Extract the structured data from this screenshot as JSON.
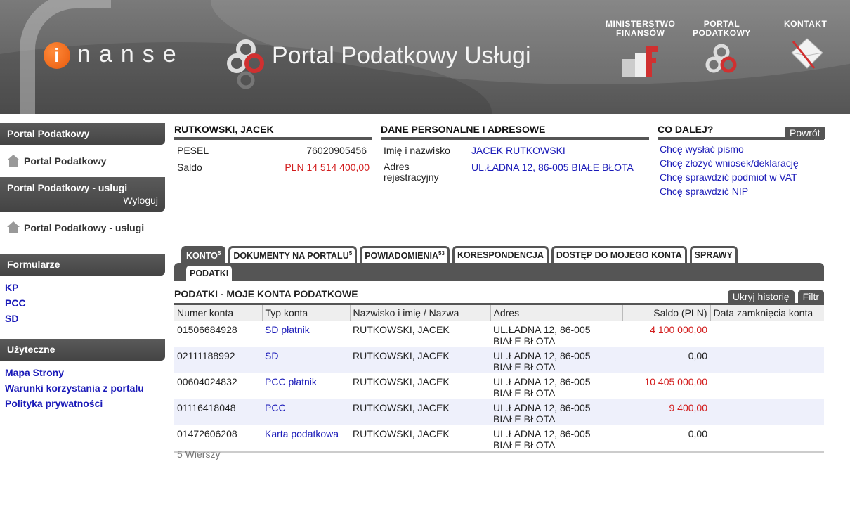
{
  "header": {
    "logo_letter": "i",
    "logo_rest": "nanse",
    "portal_title": "Portal Podatkowy Usługi",
    "links": [
      {
        "label_line1": "MINISTERSTWO",
        "label_line2": "FINANSÓW",
        "icon": "ministry-logo-icon"
      },
      {
        "label_line1": "PORTAL",
        "label_line2": "PODATKOWY",
        "icon": "portal-logo-icon"
      },
      {
        "label_line1": "KONTAKT",
        "label_line2": "",
        "icon": "envelope-icon"
      }
    ]
  },
  "sidebar": {
    "section1": {
      "title": "Portal Podatkowy",
      "home": "Portal Podatkowy"
    },
    "section2": {
      "title": "Portal Podatkowy - usługi",
      "logout": "Wyloguj",
      "home": "Portal Podatkowy - usługi"
    },
    "formularze": {
      "title": "Formularze",
      "items": [
        "KP",
        "PCC",
        "SD"
      ]
    },
    "uzyteczne": {
      "title": "Użyteczne",
      "items": [
        "Mapa Strony",
        "Warunki korzystania z portalu",
        "Polityka prywatności"
      ]
    }
  },
  "person": {
    "title": "RUTKOWSKI, JACEK",
    "pesel_label": "PESEL",
    "pesel_value": "76020905456",
    "saldo_label": "Saldo",
    "saldo_value": "PLN 14 514 400,00"
  },
  "personal": {
    "title": "DANE PERSONALNE I ADRESOWE",
    "name_label": "Imię i nazwisko",
    "name_value": "JACEK RUTKOWSKI",
    "address_label": "Adres rejestracyjny",
    "address_value": "UL.ŁADNA 12, 86-005 BIAŁE BŁOTA"
  },
  "next": {
    "title": "CO DALEJ?",
    "back_button": "Powrót",
    "links": [
      "Chcę wysłać pismo",
      "Chcę złożyć wniosek/deklarację",
      "Chcę sprawdzić podmiot w VAT",
      "Chcę sprawdzić NIP"
    ]
  },
  "tabs": [
    {
      "label": "KONTO",
      "count": "5",
      "active": true
    },
    {
      "label": "DOKUMENTY NA PORTALU",
      "count": "5",
      "active": false
    },
    {
      "label": "POWIADOMIENIA",
      "count": "53",
      "active": false
    },
    {
      "label": "KORESPONDENCJA",
      "count": "",
      "active": false
    },
    {
      "label": "DOSTĘP DO MOJEGO KONTA",
      "count": "",
      "active": false
    },
    {
      "label": "SPRAWY",
      "count": "",
      "active": false
    }
  ],
  "subtab": "PODATKI",
  "table": {
    "title": "PODATKI - MOJE KONTA PODATKOWE",
    "hide_history_button": "Ukryj historię",
    "filter_button": "Filtr",
    "columns": [
      "Numer konta",
      "Typ konta",
      "Nazwisko i imię / Nazwa",
      "Adres",
      "Saldo (PLN)",
      "Data zamknięcia konta"
    ],
    "rows": [
      {
        "number": "01506684928",
        "type": "SD płatnik",
        "name": "RUTKOWSKI, JACEK",
        "address": "UL.ŁADNA 12, 86-005 BIAŁE BŁOTA",
        "saldo": "4 100 000,00",
        "negative": true,
        "closed": ""
      },
      {
        "number": "02111188992",
        "type": "SD",
        "name": "RUTKOWSKI, JACEK",
        "address": "UL.ŁADNA 12, 86-005 BIAŁE BŁOTA",
        "saldo": "0,00",
        "negative": false,
        "closed": ""
      },
      {
        "number": "00604024832",
        "type": "PCC płatnik",
        "name": "RUTKOWSKI, JACEK",
        "address": "UL.ŁADNA 12, 86-005 BIAŁE BŁOTA",
        "saldo": "10 405 000,00",
        "negative": true,
        "closed": ""
      },
      {
        "number": "01116418048",
        "type": "PCC",
        "name": "RUTKOWSKI, JACEK",
        "address": "UL.ŁADNA 12, 86-005 BIAŁE BŁOTA",
        "saldo": "9 400,00",
        "negative": true,
        "closed": ""
      },
      {
        "number": "01472606208",
        "type": "Karta podatkowa",
        "name": "RUTKOWSKI, JACEK",
        "address": "UL.ŁADNA 12, 86-005 BIAŁE BŁOTA",
        "saldo": "0,00",
        "negative": false,
        "closed": ""
      }
    ],
    "footer": "5 Wierszy"
  },
  "colors": {
    "accent_red": "#d21c1c",
    "link_blue": "#1a1ab8",
    "bar_dark": "#555555",
    "row_alt": "#eef0fb"
  }
}
